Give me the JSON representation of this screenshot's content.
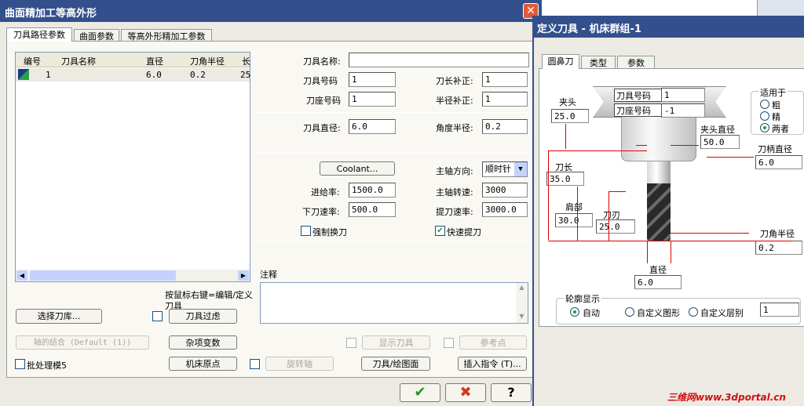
{
  "main_dialog": {
    "title": "曲面精加工等高外形",
    "tabs": [
      "刀具路径参数",
      "曲面参数",
      "等高外形精加工参数"
    ],
    "tool_table": {
      "headers": [
        "编号",
        "刀具名称",
        "直径",
        "刀角半径",
        "长"
      ],
      "rows": [
        {
          "num": "1",
          "name": "",
          "dia": "6.0",
          "corner": "0.2",
          "len": "25"
        }
      ]
    },
    "labels": {
      "tool_name": "刀具名称:",
      "tool_no": "刀具号码",
      "len_comp": "刀长补正:",
      "holder_no": "刀座号码",
      "rad_comp": "半径补正:",
      "tool_dia": "刀具直径:",
      "corner_rad": "角度半径:",
      "spindle_dir": "主轴方向:",
      "feed": "进给率:",
      "spindle_speed": "主轴转速:",
      "plunge": "下刀速率:",
      "retract": "提刀速率:",
      "force_change": "强制换刀",
      "fast_retract": "快速提刀",
      "notes": "注释",
      "hint": "按鼠标右键=编辑/定义刀具"
    },
    "values": {
      "tool_name": "",
      "tool_no": "1",
      "len_comp": "1",
      "holder_no": "1",
      "rad_comp": "1",
      "tool_dia": "6.0",
      "corner_rad": "0.2",
      "spindle_dir": "顺时针",
      "feed": "1500.0",
      "spindle_speed": "3000",
      "plunge": "500.0",
      "retract": "3000.0"
    },
    "buttons": {
      "coolant": "Coolant...",
      "select_lib": "选择刀库...",
      "tool_filter": "刀具过虑",
      "axis_combo": "轴的结合 (Default (1))",
      "misc": "杂项变数",
      "show_tool": "显示刀具",
      "ref_point": "参考点",
      "batch": "批处理模5",
      "machine_origin": "机床原点",
      "rotary": "旋转轴",
      "tool_plane": "刀具/绘图面",
      "insert_cmd": "插入指令 (T)..."
    }
  },
  "tool_dialog": {
    "title": "定义刀具 - 机床群组-1",
    "tabs": [
      "圆鼻刀",
      "类型",
      "参数"
    ],
    "labels": {
      "tool_no": "刀具号码",
      "holder_no": "刀座号码",
      "chuck": "夹头",
      "chuck_dia": "夹头直径",
      "shank_dia": "刀柄直径",
      "tool_len": "刀长",
      "shoulder": "肩部",
      "flute": "刀刃",
      "corner_rad": "刀角半径",
      "dia": "直径",
      "apply_to": "适用于",
      "rough": "粗",
      "finish": "精",
      "both": "两者",
      "profile": "轮廓显示",
      "auto": "自动",
      "custom_shape": "自定义图形",
      "custom_layer": "自定义层别"
    },
    "values": {
      "tool_no": "1",
      "holder_no": "-1",
      "chuck": "25.0",
      "chuck_dia": "50.0",
      "shank_dia": "6.0",
      "tool_len": "35.0",
      "shoulder": "30.0",
      "flute": "25.0",
      "corner_rad": "0.2",
      "dia": "6.0",
      "layer": "1"
    }
  },
  "watermark": "三维网www.3dportal.cn"
}
